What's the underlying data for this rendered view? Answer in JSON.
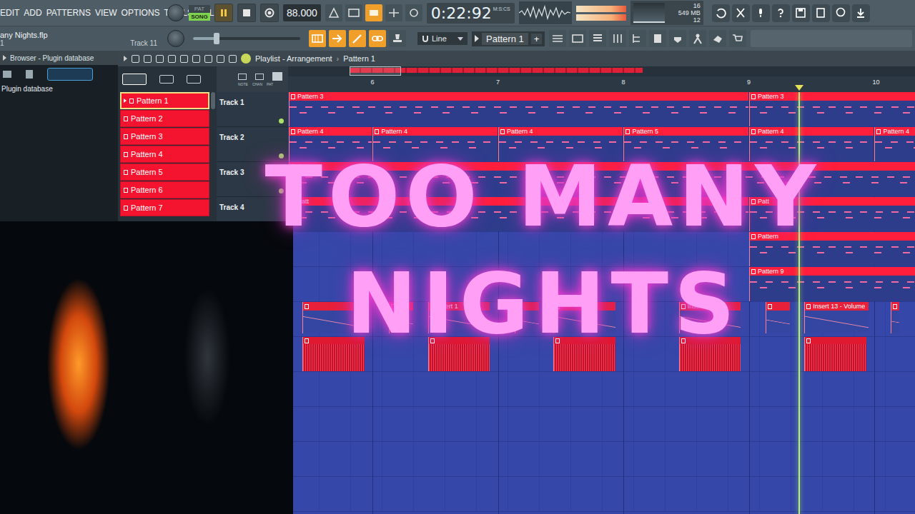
{
  "window": {
    "project": "any Nights.flp",
    "project_sub": "1",
    "track_hint": "Track 11"
  },
  "menu": [
    "EDIT",
    "ADD",
    "PATTERNS",
    "VIEW",
    "OPTIONS",
    "TOOLS",
    "HELP"
  ],
  "mode": [
    {
      "label": "PAT",
      "selected": false
    },
    {
      "label": "SONG",
      "selected": true
    }
  ],
  "transport": {
    "playing": true,
    "recording": false,
    "tempo": "88.000",
    "time": "0:22:92",
    "time_unit": "M:S:CS"
  },
  "monitor": {
    "cpu": "16",
    "memory": "549 MB",
    "polyphony": "12"
  },
  "master": {
    "level": 0.22
  },
  "snap": "Line",
  "pattern_selector": {
    "label": "Pattern 1",
    "add": "+"
  },
  "browser": {
    "title": "Browser - Plugin database",
    "item": "Plugin database"
  },
  "playlist": {
    "title": "Playlist - Arrangement",
    "separator": "›",
    "pattern": "Pattern 1",
    "picker_tabs": [
      "NOTE",
      "CHAN",
      "PAT"
    ],
    "patterns": [
      {
        "label": "Pattern 1",
        "selected": true
      },
      {
        "label": "Pattern 2",
        "selected": false
      },
      {
        "label": "Pattern 3",
        "selected": false
      },
      {
        "label": "Pattern 4",
        "selected": false
      },
      {
        "label": "Pattern 5",
        "selected": false
      },
      {
        "label": "Pattern 6",
        "selected": false
      },
      {
        "label": "Pattern 7",
        "selected": false
      }
    ],
    "tracks": [
      {
        "name": "Track 1",
        "enabled": true
      },
      {
        "name": "Track 2",
        "enabled": true
      },
      {
        "name": "Track 3",
        "enabled": true
      },
      {
        "name": "Track 4",
        "enabled": true
      }
    ],
    "ruler": [
      {
        "label": "6",
        "bar": 6
      },
      {
        "label": "7",
        "bar": 7
      },
      {
        "label": "8",
        "bar": 8
      },
      {
        "label": "9",
        "bar": 9
      },
      {
        "label": "10",
        "bar": 10
      }
    ],
    "playhead": 9.4,
    "clips": [
      {
        "label": "Pattern 3",
        "kind": "pattern",
        "track": 1,
        "start": 5.33,
        "length": 3.67
      },
      {
        "label": "Pattern 3",
        "kind": "pattern",
        "track": 1,
        "start": 9,
        "length": 2
      },
      {
        "label": "Pattern 4",
        "kind": "pattern",
        "track": 2,
        "start": 5.33,
        "length": 0.67
      },
      {
        "label": "Pattern 4",
        "kind": "pattern",
        "track": 2,
        "start": 6,
        "length": 1
      },
      {
        "label": "Pattern 4",
        "kind": "pattern",
        "track": 2,
        "start": 7,
        "length": 1
      },
      {
        "label": "Pattern 5",
        "kind": "pattern",
        "track": 2,
        "start": 8,
        "length": 1
      },
      {
        "label": "Pattern 4",
        "kind": "pattern",
        "track": 2,
        "start": 9,
        "length": 1
      },
      {
        "label": "Pattern 4",
        "kind": "pattern",
        "track": 2,
        "start": 10,
        "length": 1
      },
      {
        "label": "Patte",
        "kind": "pattern",
        "track": 3,
        "start": 5.33,
        "length": 5.67
      },
      {
        "label": "Patt",
        "kind": "pattern",
        "track": 4,
        "start": 5.33,
        "length": 3.67
      },
      {
        "label": "Patt",
        "kind": "pattern",
        "track": 4,
        "start": 9,
        "length": 2
      },
      {
        "label": "Pattern",
        "kind": "pattern",
        "track": 5,
        "start": 9,
        "length": 2
      },
      {
        "label": "Pattern 9",
        "kind": "pattern",
        "track": 6,
        "start": 9,
        "length": 2
      },
      {
        "label": "",
        "kind": "automation",
        "track": 7,
        "start": 5.44,
        "length": 0.5
      },
      {
        "label": "",
        "kind": "automation",
        "track": 7,
        "start": 6.13,
        "length": 0.2
      },
      {
        "label": "Insert 1",
        "kind": "automation",
        "track": 7,
        "start": 6.44,
        "length": 0.5
      },
      {
        "label": "",
        "kind": "automation",
        "track": 7,
        "start": 7.13,
        "length": 0.2
      },
      {
        "label": "",
        "kind": "automation",
        "track": 7,
        "start": 7.44,
        "length": 0.5
      },
      {
        "label": "Insert",
        "kind": "automation",
        "track": 7,
        "start": 8.44,
        "length": 0.5
      },
      {
        "label": "",
        "kind": "automation",
        "track": 7,
        "start": 9.13,
        "length": 0.2
      },
      {
        "label": "Insert 13 - Volume",
        "kind": "automation",
        "track": 7,
        "start": 9.44,
        "length": 0.52
      },
      {
        "label": "",
        "kind": "automation",
        "track": 7,
        "start": 10.13,
        "length": 0.07
      },
      {
        "label": "",
        "kind": "audio",
        "track": 8,
        "start": 5.44,
        "length": 0.5
      },
      {
        "label": "",
        "kind": "audio",
        "track": 8,
        "start": 6.44,
        "length": 0.5
      },
      {
        "label": "",
        "kind": "audio",
        "track": 8,
        "start": 7.44,
        "length": 0.5
      },
      {
        "label": "",
        "kind": "audio",
        "track": 8,
        "start": 8.44,
        "length": 0.5
      },
      {
        "label": "",
        "kind": "audio",
        "track": 8,
        "start": 9.44,
        "length": 0.5
      }
    ]
  },
  "overlay": {
    "lines": [
      "TOO MANY",
      "NIGHTS"
    ]
  }
}
